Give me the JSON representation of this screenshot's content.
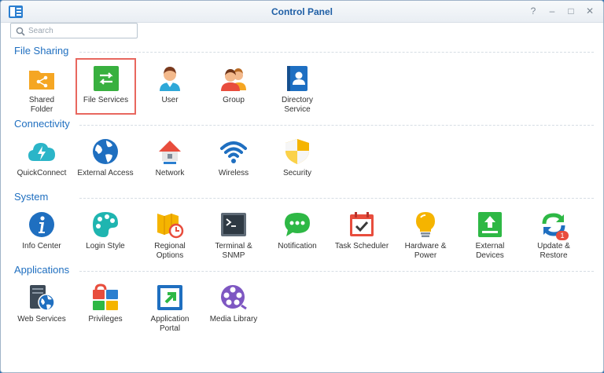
{
  "window": {
    "title": "Control Panel"
  },
  "search": {
    "placeholder": "Search"
  },
  "colors": {
    "accent": "#1f6fc0",
    "selection": "#e8675f"
  },
  "sections": [
    {
      "title": "File Sharing",
      "items": [
        {
          "label": "Shared\nFolder",
          "icon": "shared-folder-icon"
        },
        {
          "label": "File Services",
          "icon": "file-services-icon",
          "selected": true
        },
        {
          "label": "User",
          "icon": "user-icon"
        },
        {
          "label": "Group",
          "icon": "group-icon"
        },
        {
          "label": "Directory\nService",
          "icon": "directory-service-icon"
        }
      ]
    },
    {
      "title": "Connectivity",
      "items": [
        {
          "label": "QuickConnect",
          "icon": "quickconnect-icon"
        },
        {
          "label": "External Access",
          "icon": "external-access-icon"
        },
        {
          "label": "Network",
          "icon": "network-icon"
        },
        {
          "label": "Wireless",
          "icon": "wireless-icon"
        },
        {
          "label": "Security",
          "icon": "security-icon"
        }
      ]
    },
    {
      "title": "System",
      "items": [
        {
          "label": "Info Center",
          "icon": "info-center-icon"
        },
        {
          "label": "Login Style",
          "icon": "login-style-icon"
        },
        {
          "label": "Regional\nOptions",
          "icon": "regional-options-icon"
        },
        {
          "label": "Terminal &\nSNMP",
          "icon": "terminal-icon"
        },
        {
          "label": "Notification",
          "icon": "notification-icon"
        },
        {
          "label": "Task Scheduler",
          "icon": "task-scheduler-icon"
        },
        {
          "label": "Hardware &\nPower",
          "icon": "hardware-power-icon"
        },
        {
          "label": "External\nDevices",
          "icon": "external-devices-icon"
        },
        {
          "label": "Update &\nRestore",
          "icon": "update-restore-icon",
          "badge": "1"
        }
      ]
    },
    {
      "title": "Applications",
      "items": [
        {
          "label": "Web Services",
          "icon": "web-services-icon"
        },
        {
          "label": "Privileges",
          "icon": "privileges-icon"
        },
        {
          "label": "Application\nPortal",
          "icon": "application-portal-icon"
        },
        {
          "label": "Media Library",
          "icon": "media-library-icon"
        }
      ]
    }
  ]
}
